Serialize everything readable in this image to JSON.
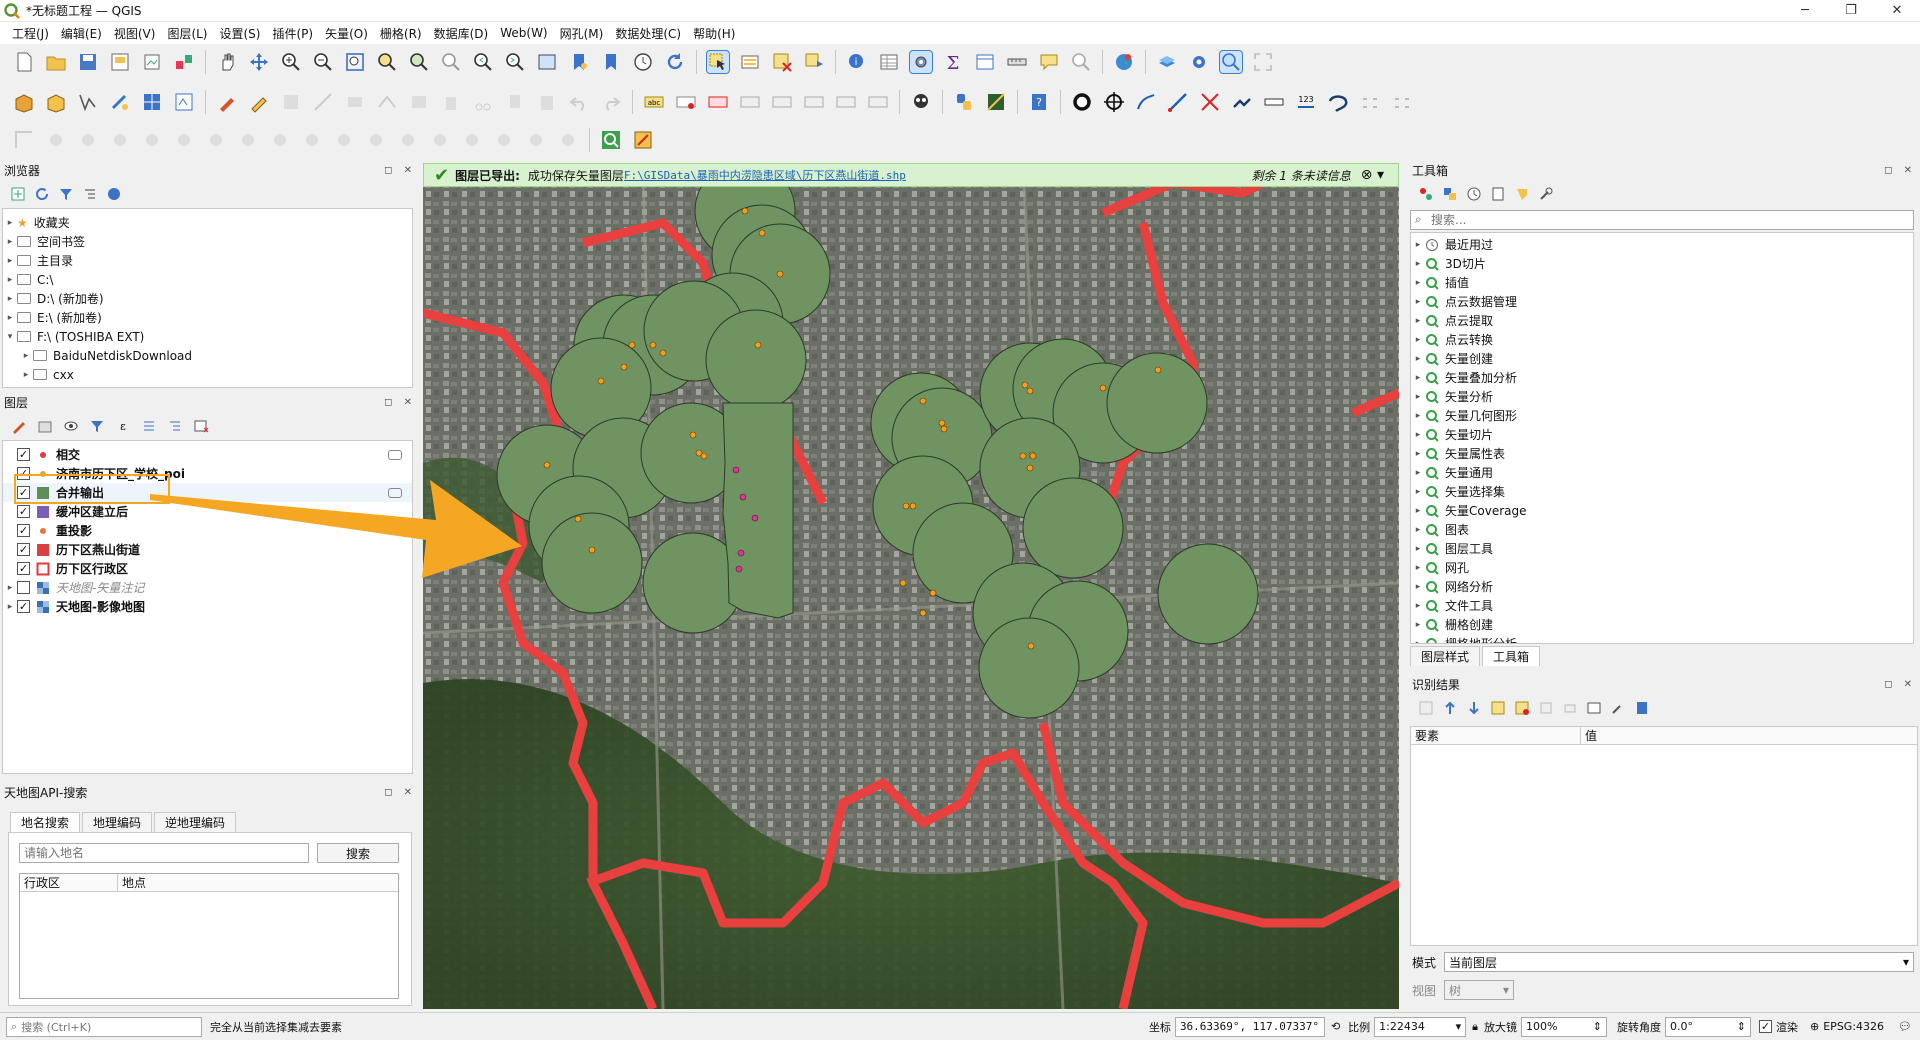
{
  "window": {
    "title": "*无标题工程 — QGIS",
    "controls": [
      "─",
      "❐",
      "✕"
    ]
  },
  "menu": [
    "工程(J)",
    "编辑(E)",
    "视图(V)",
    "图层(L)",
    "设置(S)",
    "插件(P)",
    "矢量(O)",
    "栅格(R)",
    "数据库(D)",
    "Web(W)",
    "网孔(M)",
    "数据处理(C)",
    "帮助(H)"
  ],
  "browser": {
    "title": "浏览器",
    "items": [
      {
        "label": "收藏夹",
        "icon": "star-icon"
      },
      {
        "label": "空间书签",
        "icon": "bookmark-icon"
      },
      {
        "label": "主目录",
        "icon": "home-icon"
      },
      {
        "label": "C:\\",
        "icon": "drive-icon"
      },
      {
        "label": "D:\\ (新加卷)",
        "icon": "drive-icon"
      },
      {
        "label": "E:\\ (新加卷)",
        "icon": "drive-icon"
      },
      {
        "label": "F:\\ (TOSHIBA EXT)",
        "icon": "drive-icon"
      },
      {
        "label": "BaiduNetdiskDownload",
        "icon": "folder-icon"
      },
      {
        "label": "cxx",
        "icon": "folder-icon"
      }
    ]
  },
  "layers": {
    "title": "图层",
    "items": [
      {
        "label": "相交",
        "checked": true,
        "symbol": "dot",
        "color": "#e03a3a"
      },
      {
        "label": "济南市历下区_学校_poi",
        "checked": true,
        "symbol": "dot",
        "color": "#e8a23a"
      },
      {
        "label": "合并输出",
        "checked": true,
        "symbol": "fill",
        "color": "#5f8f55"
      },
      {
        "label": "缓冲区建立后",
        "checked": true,
        "symbol": "fill",
        "color": "#7b5fb5"
      },
      {
        "label": "重投影",
        "checked": true,
        "symbol": "dot",
        "color": "#e8743a"
      },
      {
        "label": "历下区燕山街道",
        "checked": true,
        "symbol": "fill",
        "color": "#d94040"
      },
      {
        "label": "历下区行政区",
        "checked": true,
        "symbol": "outline",
        "color": "#e03a3a"
      },
      {
        "label": "天地图-矢量注记",
        "checked": false,
        "symbol": "raster",
        "color": "#3a6fb0"
      },
      {
        "label": "天地图-影像地图",
        "checked": true,
        "symbol": "raster",
        "color": "#3a6fb0"
      }
    ]
  },
  "tianditu": {
    "title": "天地图API-搜索",
    "tabs": [
      "地名搜索",
      "地理编码",
      "逆地理编码"
    ],
    "placeholder": "请输入地名",
    "search_label": "搜索",
    "columns": [
      "行政区",
      "地点"
    ]
  },
  "message": {
    "heading": "图层已导出:",
    "text": "成功保存矢量图层",
    "path": "F:\\GISData\\暴雨中内涝隐患区域\\历下区燕山街道.shp",
    "more": "剩余 1 条未读信息"
  },
  "toolbox": {
    "title": "工具箱",
    "search_placeholder": "搜索...",
    "items": [
      "最近用过",
      "3D切片",
      "插值",
      "点云数据管理",
      "点云提取",
      "点云转换",
      "矢量创建",
      "矢量叠加分析",
      "矢量分析",
      "矢量几何图形",
      "矢量切片",
      "矢量属性表",
      "矢量通用",
      "矢量选择集",
      "矢量Coverage",
      "图表",
      "图层工具",
      "网孔",
      "网络分析",
      "文件工具",
      "栅格创建",
      "栅格地形分析"
    ],
    "tabs": [
      "图层样式",
      "工具箱"
    ]
  },
  "identify": {
    "title": "识别结果",
    "columns": [
      "要素",
      "值"
    ],
    "mode_label": "模式",
    "mode_value": "当前图层",
    "view_label": "视图",
    "view_value": "树"
  },
  "status": {
    "search_placeholder": "搜索 (Ctrl+K)",
    "message": "完全从当前选择集减去要素",
    "coord_label": "坐标",
    "coord_value": "36.63369°, 117.07337°",
    "scale_label": "比例",
    "scale_value": "1:22434",
    "magnifier_label": "放大镜",
    "magnifier_value": "100%",
    "rotation_label": "旋转角度",
    "rotation_value": "0.0°",
    "render_label": "渲染",
    "crs": "EPSG:4326"
  },
  "colors": {
    "buffer_fill": "#6f9462",
    "boundary": "#e8403f",
    "poi": "#f0a020",
    "intersect_poi": "#d63a8e",
    "highlight": "#f5a623"
  }
}
